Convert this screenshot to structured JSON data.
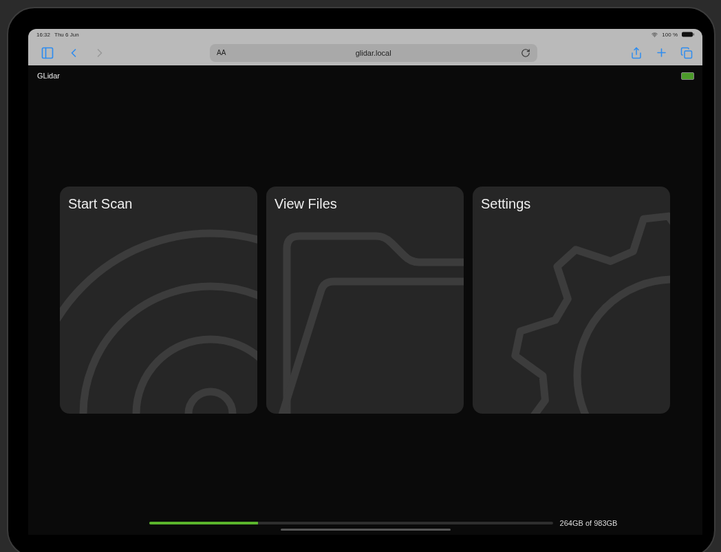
{
  "status_bar": {
    "time": "16:32",
    "date": "Thu 6 Jun",
    "battery": "100 %"
  },
  "browser_toolbar": {
    "text_size": "AA",
    "url": "glidar.local"
  },
  "app": {
    "title": "GLidar"
  },
  "cards": [
    {
      "kind": "scan",
      "label": "Start Scan"
    },
    {
      "kind": "files",
      "label": "View Files"
    },
    {
      "kind": "settings",
      "label": "Settings"
    }
  ],
  "storage": {
    "level": 0.27,
    "reading": "264GB of 983GB"
  }
}
